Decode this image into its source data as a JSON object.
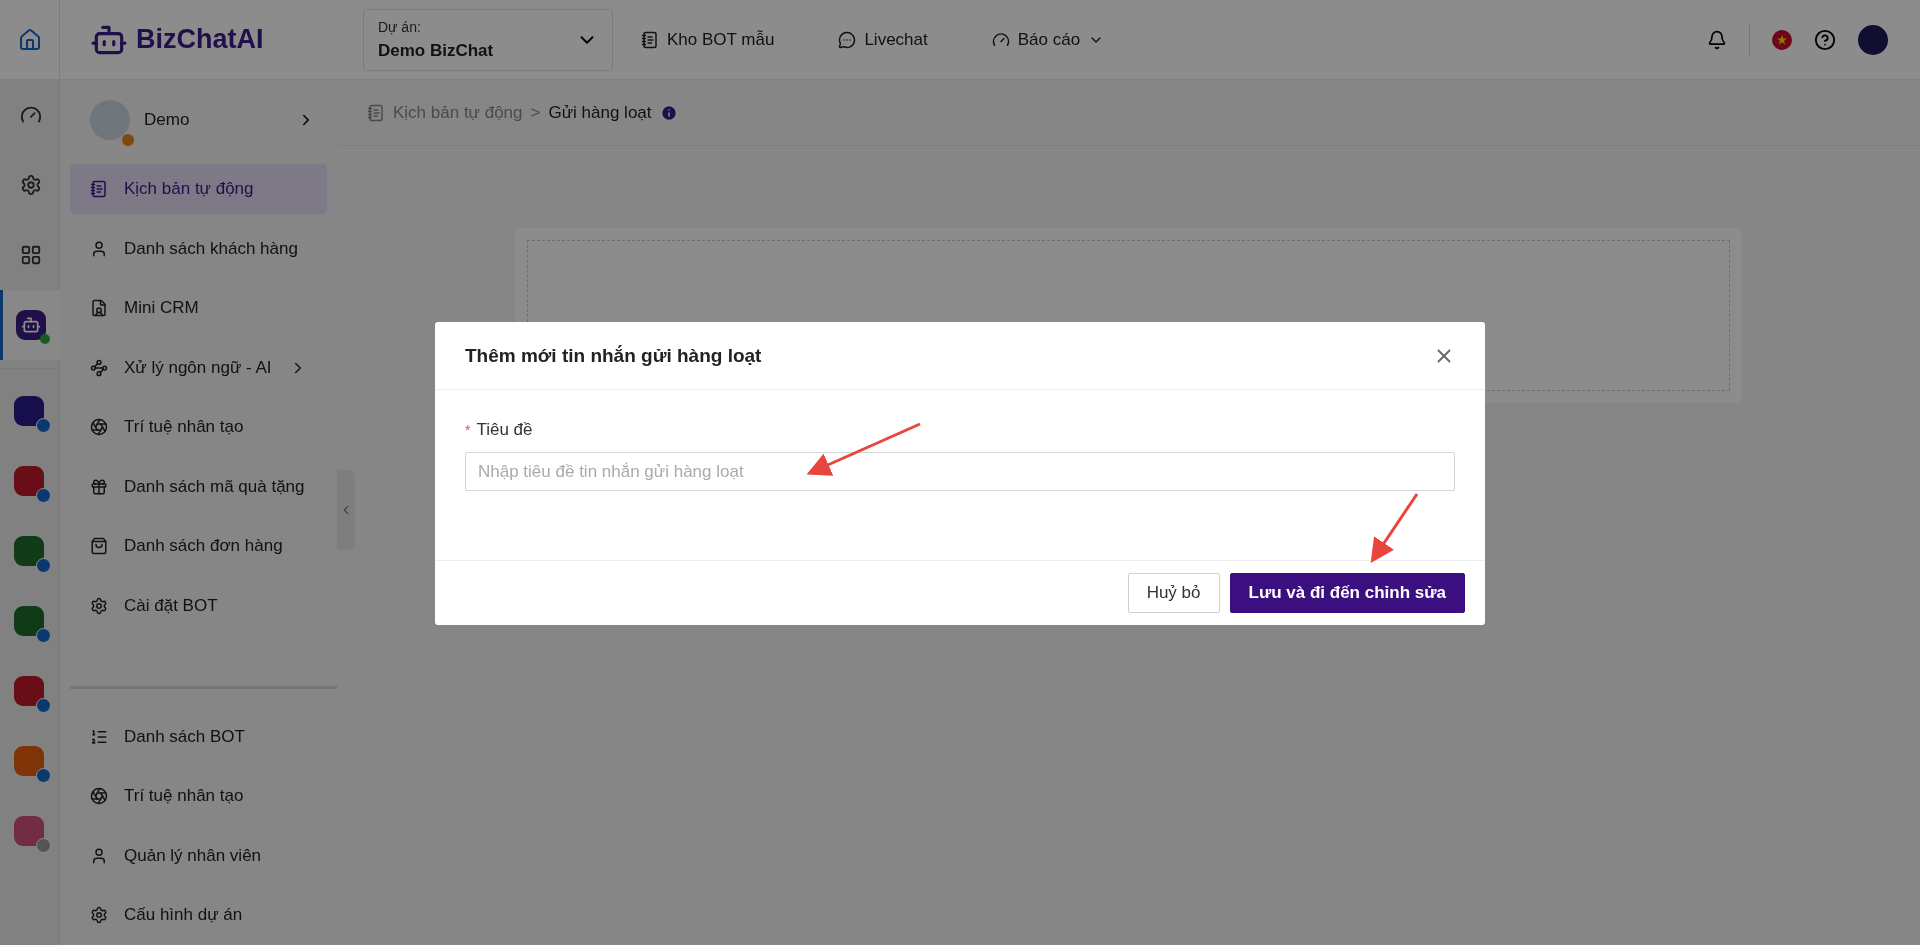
{
  "topbar": {
    "logo": "BizChatAI",
    "project": {
      "label": "Dự án:",
      "value": "Demo BizChat"
    },
    "nav": [
      {
        "label": "Kho BOT mẫu",
        "dropdown": false
      },
      {
        "label": "Livechat",
        "dropdown": false
      },
      {
        "label": "Báo cáo",
        "dropdown": true
      }
    ]
  },
  "rail": {
    "items": [
      {
        "selected": false
      },
      {
        "selected": false
      },
      {
        "selected": false
      },
      {
        "selected": true
      }
    ],
    "apps": [
      {
        "enabled": true
      },
      {
        "enabled": true
      },
      {
        "enabled": true
      },
      {
        "enabled": true
      },
      {
        "enabled": true
      },
      {
        "enabled": true
      },
      {
        "enabled": false
      }
    ]
  },
  "sidebar": {
    "bot_name": "Demo",
    "items": [
      {
        "label": "Kịch bản tự động",
        "selected": true,
        "expandable": false
      },
      {
        "label": "Danh sách khách hàng",
        "selected": false,
        "expandable": false
      },
      {
        "label": "Mini CRM",
        "selected": false,
        "expandable": false
      },
      {
        "label": "Xử lý ngôn ngữ - AI",
        "selected": false,
        "expandable": true
      },
      {
        "label": "Trí tuệ nhân tạo",
        "selected": false,
        "expandable": false
      },
      {
        "label": "Danh sách mã quà tặng",
        "selected": false,
        "expandable": false
      },
      {
        "label": "Danh sách đơn hàng",
        "selected": false,
        "expandable": false
      },
      {
        "label": "Cài đặt BOT",
        "selected": false,
        "expandable": false
      }
    ],
    "bottom_items": [
      {
        "label": "Danh sách BOT"
      },
      {
        "label": "Trí tuệ nhân tạo"
      },
      {
        "label": "Quản lý nhân viên"
      },
      {
        "label": "Cấu hình dự án"
      }
    ]
  },
  "breadcrumb": {
    "items": [
      "Kịch bản tự động",
      "Gửi hàng loạt"
    ],
    "separator": ">"
  },
  "modal": {
    "title": "Thêm mới tin nhắn gửi hàng loạt",
    "field": {
      "label": "Tiêu đề",
      "required_mark": "*",
      "placeholder": "Nhập tiêu đề tin nhắn gửi hàng loạt"
    },
    "buttons": [
      {
        "label": "Huỷ bỏ",
        "kind": "default"
      },
      {
        "label": "Lưu và đi đến chỉnh sửa",
        "kind": "primary"
      }
    ]
  }
}
